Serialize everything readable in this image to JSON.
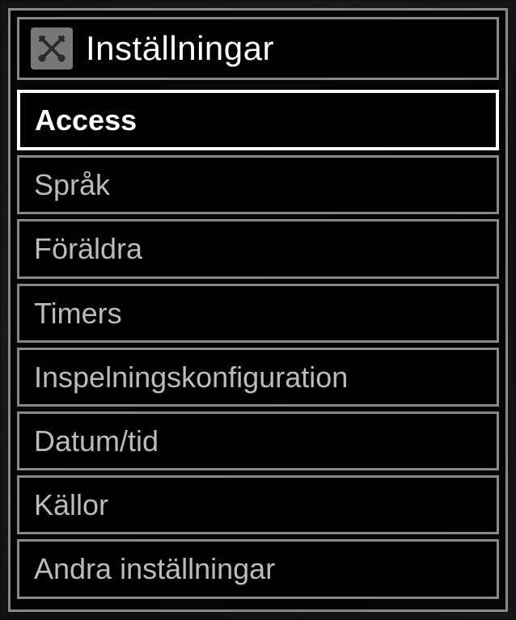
{
  "header": {
    "title": "Inställningar",
    "icon": "tools-icon"
  },
  "menu": {
    "selected_index": 0,
    "items": [
      {
        "label": "Access"
      },
      {
        "label": "Språk"
      },
      {
        "label": "Föräldra"
      },
      {
        "label": "Timers"
      },
      {
        "label": "Inspelningskonfiguration"
      },
      {
        "label": "Datum/tid"
      },
      {
        "label": "Källor"
      },
      {
        "label": "Andra inställningar"
      }
    ]
  }
}
